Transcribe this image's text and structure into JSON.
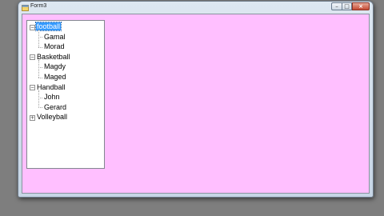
{
  "window": {
    "title": "Form3",
    "client_color": "#ffbfff",
    "minimize_icon": "minimize-icon",
    "maximize_icon": "maximize-icon",
    "close_icon": "close-icon"
  },
  "tree": {
    "nodes": [
      {
        "label": "football",
        "expanded": true,
        "selected": true,
        "children": [
          {
            "label": "Gamal"
          },
          {
            "label": "Morad"
          }
        ]
      },
      {
        "label": "Basketball",
        "expanded": true,
        "children": [
          {
            "label": "Magdy"
          },
          {
            "label": "Maged"
          }
        ]
      },
      {
        "label": "Handball",
        "expanded": true,
        "children": [
          {
            "label": "John"
          },
          {
            "label": "Gerard"
          }
        ]
      },
      {
        "label": "Volleyball",
        "expanded": false,
        "children": []
      }
    ],
    "selection_color": "#3399ff"
  }
}
